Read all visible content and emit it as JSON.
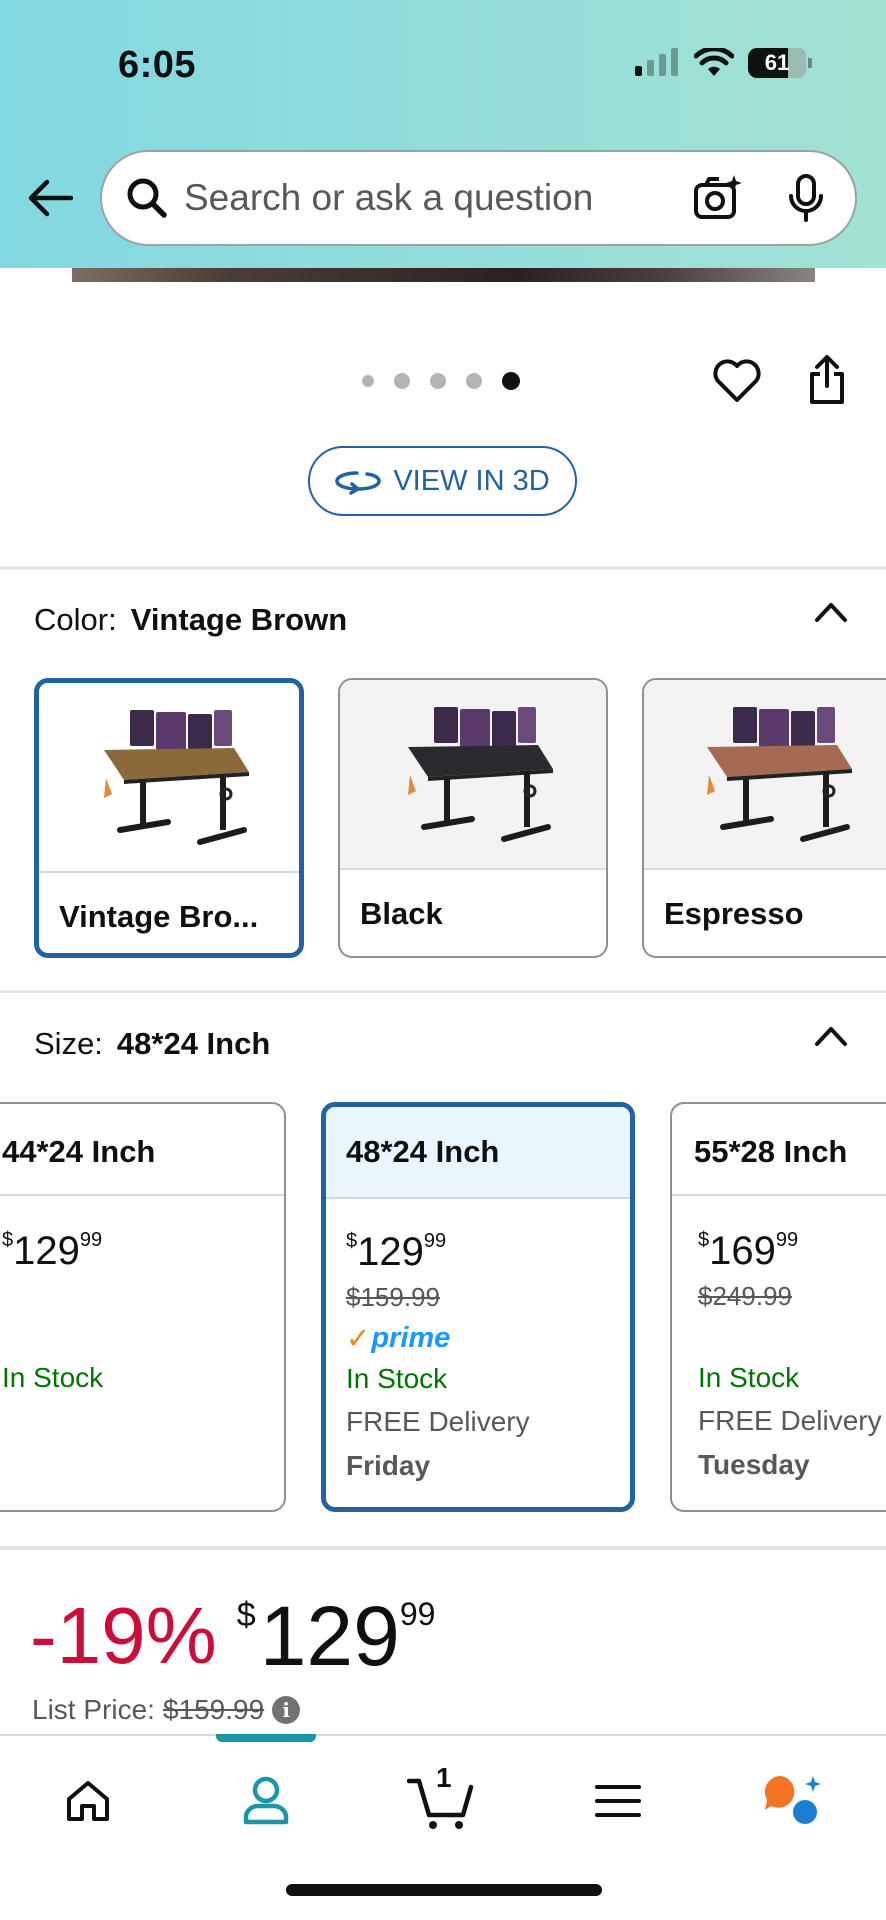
{
  "status_bar": {
    "time": "6:05",
    "battery": "61"
  },
  "search": {
    "placeholder": "Search or ask a question"
  },
  "image_gallery": {
    "total_images": 5,
    "active_index": 4
  },
  "view3d": {
    "label": "VIEW IN 3D"
  },
  "color": {
    "label": "Color:",
    "selected": "Vintage Brown",
    "options": [
      {
        "name": "Vintage Bro...",
        "top_color": "#8a6a3a"
      },
      {
        "name": "Black",
        "top_color": "#2a2a2e"
      },
      {
        "name": "Espresso",
        "top_color": "#a66a52"
      }
    ]
  },
  "size": {
    "label": "Size:",
    "selected": "48*24 Inch",
    "options": [
      {
        "name": "44*24 Inch",
        "price_whole": "129",
        "price_frac": "99",
        "list_price": "",
        "prime": false,
        "stock": "In Stock",
        "delivery": "",
        "delivery_day": ""
      },
      {
        "name": "48*24 Inch",
        "price_whole": "129",
        "price_frac": "99",
        "list_price": "$159.99",
        "prime": true,
        "stock": "In Stock",
        "delivery": "FREE Delivery",
        "delivery_day": "Friday"
      },
      {
        "name": "55*28 Inch",
        "price_whole": "169",
        "price_frac": "99",
        "list_price": "$249.99",
        "prime": false,
        "stock": "In Stock",
        "delivery": "FREE Delivery",
        "delivery_day": "Tuesday"
      }
    ],
    "currency": "$",
    "prime_label": "prime"
  },
  "price": {
    "discount": "-19%",
    "currency": "$",
    "whole": "129",
    "fraction": "99",
    "list_label": "List Price:",
    "list_value": "$159.99",
    "info": "i"
  },
  "bottom_nav": {
    "items": [
      "home",
      "account",
      "cart",
      "menu",
      "rufus"
    ],
    "active": "account",
    "cart_count": "1"
  },
  "colors": {
    "link_blue": "#2162a1",
    "deal_red": "#cc0c39",
    "stock_green": "#007600",
    "nav_teal": "#1a96a6"
  }
}
